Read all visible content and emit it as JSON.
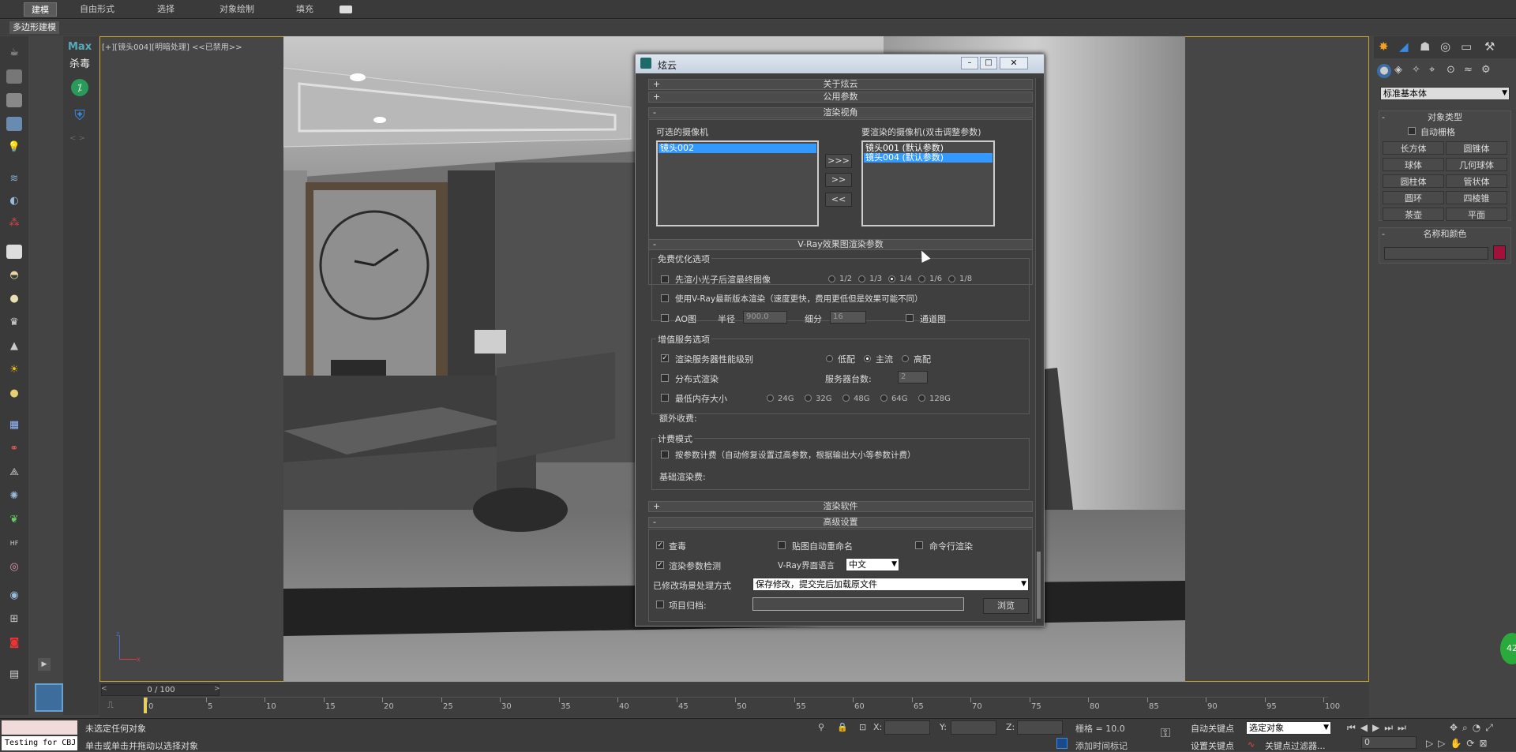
{
  "ribbon": {
    "tabs": [
      "建模",
      "自由形式",
      "选择",
      "对象绘制",
      "填充"
    ],
    "active_tab": 0,
    "sub_label": "多边形建模"
  },
  "left_plugins": {
    "max_label": "Max",
    "antivirus_label": "杀毒"
  },
  "viewport": {
    "label": "[+][镜头004][明暗处理] <<已禁用>>"
  },
  "dialog": {
    "title": "炫云",
    "rollouts": {
      "about": "关于炫云",
      "common": "公用参数",
      "render_view": "渲染视角",
      "vray": "V-Ray效果图渲染参数",
      "render_software": "渲染软件",
      "advanced": "高级设置"
    },
    "cameras": {
      "available_label": "可选的摄像机",
      "render_label": "要渲染的摄像机(双击调整参数)",
      "available": [
        "镜头002"
      ],
      "selected": [
        "镜头001 (默认参数)",
        "镜头004 (默认参数)"
      ],
      "buttons": [
        ">>>",
        ">>",
        "<<"
      ]
    },
    "free_opt": {
      "group_label": "免费优化选项",
      "small_light_label": "先渲小光子后渲最终图像",
      "ratios": [
        "1/2",
        "1/3",
        "1/4",
        "1/6",
        "1/8"
      ],
      "ratio_selected": 2,
      "new_vray_label": "使用V-Ray最新版本渲染（速度更快，费用更低但是效果可能不同）",
      "ao_label": "AO图",
      "radius_label": "半径",
      "radius_value": "900.0",
      "subdiv_label": "细分",
      "subdiv_value": "16",
      "channel_label": "通道图"
    },
    "value_added": {
      "group_label": "增值服务选项",
      "server_level_label": "渲染服务器性能级别",
      "levels": [
        "低配",
        "主流",
        "高配"
      ],
      "level_selected": 1,
      "distributed_label": "分布式渲染",
      "server_count_label": "服务器台数:",
      "server_count_value": "2",
      "min_mem_label": "最低内存大小",
      "mem_options": [
        "24G",
        "32G",
        "48G",
        "64G",
        "128G"
      ],
      "extra_fee_label": "额外收费:"
    },
    "billing": {
      "group_label": "计费模式",
      "by_param_label": "按参数计费（自动修复设置过高参数，根据输出大小等参数计费）",
      "base_fee_label": "基础渲染费:"
    },
    "advanced": {
      "antivirus_label": "查毒",
      "antivirus_checked": true,
      "auto_rename_label": "贴图自动重命名",
      "cmdline_label": "命令行渲染",
      "param_check_label": "渲染参数检测",
      "param_check_checked": true,
      "vray_lang_label": "V-Ray界面语言",
      "vray_lang_value": "中文",
      "scene_mod_label": "已修改场景处理方式",
      "scene_mod_value": "保存修改，提交完后加载原文件",
      "archive_label": "项目归档:",
      "browse_label": "浏览"
    }
  },
  "command_panel": {
    "dropdown": "标准基本体",
    "object_type_title": "对象类型",
    "autogrid_label": "自动栅格",
    "buttons": [
      "长方体",
      "圆锥体",
      "球体",
      "几何球体",
      "圆柱体",
      "管状体",
      "圆环",
      "四棱锥",
      "茶壶",
      "平面"
    ],
    "name_color_title": "名称和颜色",
    "swatch_color": "#a0123a"
  },
  "timeline": {
    "frame_counter": "0 / 100",
    "ticks": [
      "0",
      "5",
      "10",
      "15",
      "20",
      "25",
      "30",
      "35",
      "40",
      "45",
      "50",
      "55",
      "60",
      "65",
      "70",
      "75",
      "80",
      "85",
      "90",
      "95",
      "100"
    ]
  },
  "status": {
    "selection": "未选定任何对象",
    "prompt": "单击或单击并拖动以选择对象",
    "script_label": "Testing for CBJ",
    "x_label": "X:",
    "y_label": "Y:",
    "z_label": "Z:",
    "grid_label": "栅格 = 10.0",
    "auto_key": "自动关键点",
    "set_key": "设置关键点",
    "selected_object": "选定对象",
    "key_filters": "关键点过滤器...",
    "add_time_tag": "添加时间标记",
    "frame_value": "0"
  }
}
